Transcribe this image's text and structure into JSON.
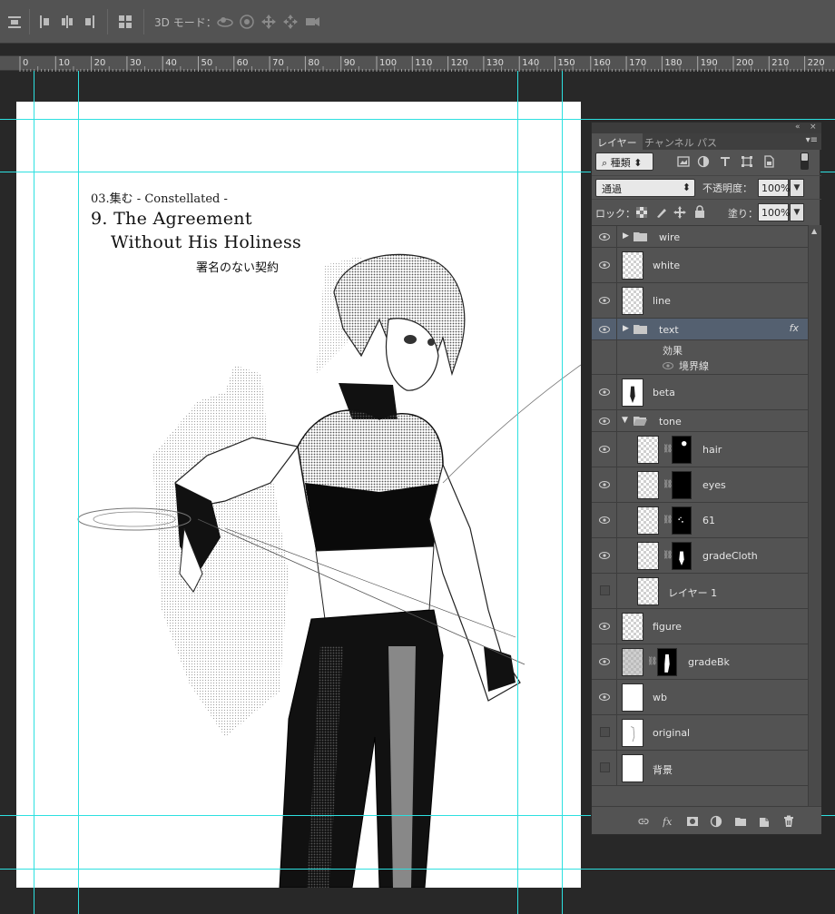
{
  "options_bar": {
    "mode_3d_label": "3D モード："
  },
  "ruler": {
    "ticks": [
      "0",
      "10",
      "20",
      "30",
      "40",
      "50",
      "60",
      "70",
      "80",
      "90",
      "100",
      "110",
      "120",
      "130",
      "140",
      "150",
      "160",
      "170",
      "180",
      "190",
      "200",
      "210",
      "220"
    ]
  },
  "canvas": {
    "subtitle": "03.集む  - Constellated -",
    "title_line1": "9. The Agreement",
    "title_line2": "Without His Holiness",
    "title_jp": "署名のない契約"
  },
  "panel": {
    "collapse_icon": "double-chevron-icon",
    "close_label": "×",
    "tabs": [
      {
        "label": "レイヤー",
        "active": true
      },
      {
        "label": "チャンネル",
        "active": false
      },
      {
        "label": "パス",
        "active": false
      }
    ],
    "menu_icon": "panel-menu-icon",
    "filter_kind": "種類",
    "blend_mode": "通過",
    "opacity_label": "不透明度：",
    "opacity_value": "100%",
    "lock_label": "ロック：",
    "fill_label": "塗り：",
    "fill_value": "100%",
    "layers": [
      {
        "name": "wire",
        "type": "group",
        "visible": true,
        "expanded": false
      },
      {
        "name": "white",
        "type": "layer",
        "visible": true
      },
      {
        "name": "line",
        "type": "layer",
        "visible": true
      },
      {
        "name": "text",
        "type": "group",
        "visible": true,
        "expanded": false,
        "selected": true,
        "fx": true
      },
      {
        "name": "beta",
        "type": "layer",
        "visible": true
      },
      {
        "name": "tone",
        "type": "group",
        "visible": true,
        "expanded": true
      },
      {
        "name": "hair",
        "type": "masked",
        "visible": true
      },
      {
        "name": "eyes",
        "type": "masked",
        "visible": true
      },
      {
        "name": "61",
        "type": "masked",
        "visible": true
      },
      {
        "name": "gradeCloth",
        "type": "masked",
        "visible": true
      },
      {
        "name": "レイヤー 1",
        "type": "layer",
        "visible": false
      },
      {
        "name": "figure",
        "type": "layer",
        "visible": true
      },
      {
        "name": "gradeBk",
        "type": "masked",
        "visible": true
      },
      {
        "name": "wb",
        "type": "layer",
        "visible": true
      },
      {
        "name": "original",
        "type": "layer",
        "visible": false
      },
      {
        "name": "背景",
        "type": "layer",
        "visible": false
      }
    ],
    "effects_label": "効果",
    "effect_stroke": "境界線",
    "fx_label": "fx"
  },
  "colors": {
    "guide": "#2de0e0",
    "selected_layer": "#546070",
    "panel_bg": "#535353",
    "workspace": "#282828"
  }
}
